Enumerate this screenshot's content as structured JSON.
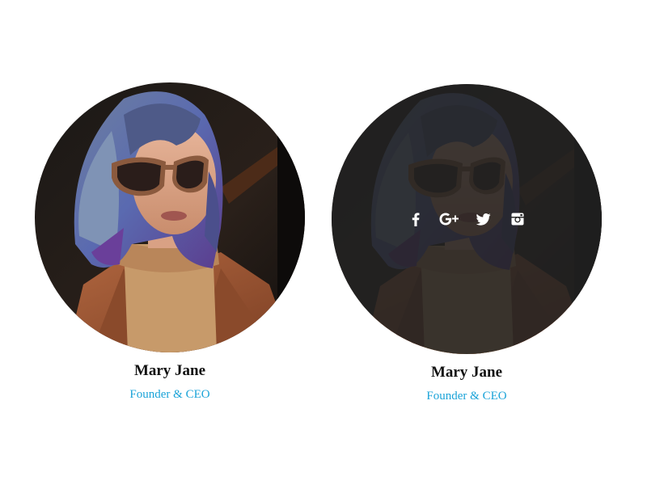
{
  "cards": [
    {
      "name": "Mary Jane",
      "role": "Founder & CEO",
      "state": "default"
    },
    {
      "name": "Mary Jane",
      "role": "Founder & CEO",
      "state": "hover",
      "social": [
        "facebook-icon",
        "google-plus-icon",
        "twitter-icon",
        "instagram-icon"
      ]
    }
  ],
  "colors": {
    "role_text": "#1aa3d8",
    "name_text": "#111111",
    "overlay": "#222222",
    "social_icon": "#ffffff"
  }
}
